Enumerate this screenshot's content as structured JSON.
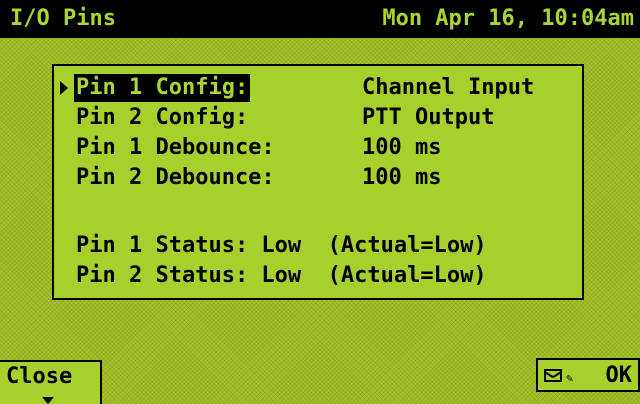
{
  "titlebar": {
    "title": "I/O Pins",
    "datetime": "Mon Apr 16, 10:04am"
  },
  "config": {
    "rows": [
      {
        "label": "Pin 1 Config:",
        "value": "Channel Input",
        "selected": true
      },
      {
        "label": "Pin 2 Config:",
        "value": "PTT Output"
      },
      {
        "label": "Pin 1 Debounce:",
        "value": "100 ms"
      },
      {
        "label": "Pin 2 Debounce:",
        "value": "100 ms"
      }
    ]
  },
  "status": {
    "rows": [
      {
        "text": "Pin 1 Status: Low  (Actual=Low)"
      },
      {
        "text": "Pin 2 Status: Low  (Actual=Low)"
      }
    ]
  },
  "softkeys": {
    "left_label": "Close",
    "right_label": "OK",
    "right_icons": [
      "mail-icon",
      "pen-icon"
    ]
  },
  "colors": {
    "lcd_background": "#a6c52a",
    "titlebar_background": "#000000",
    "text": "#000000",
    "highlight_text": "#a9d632"
  }
}
